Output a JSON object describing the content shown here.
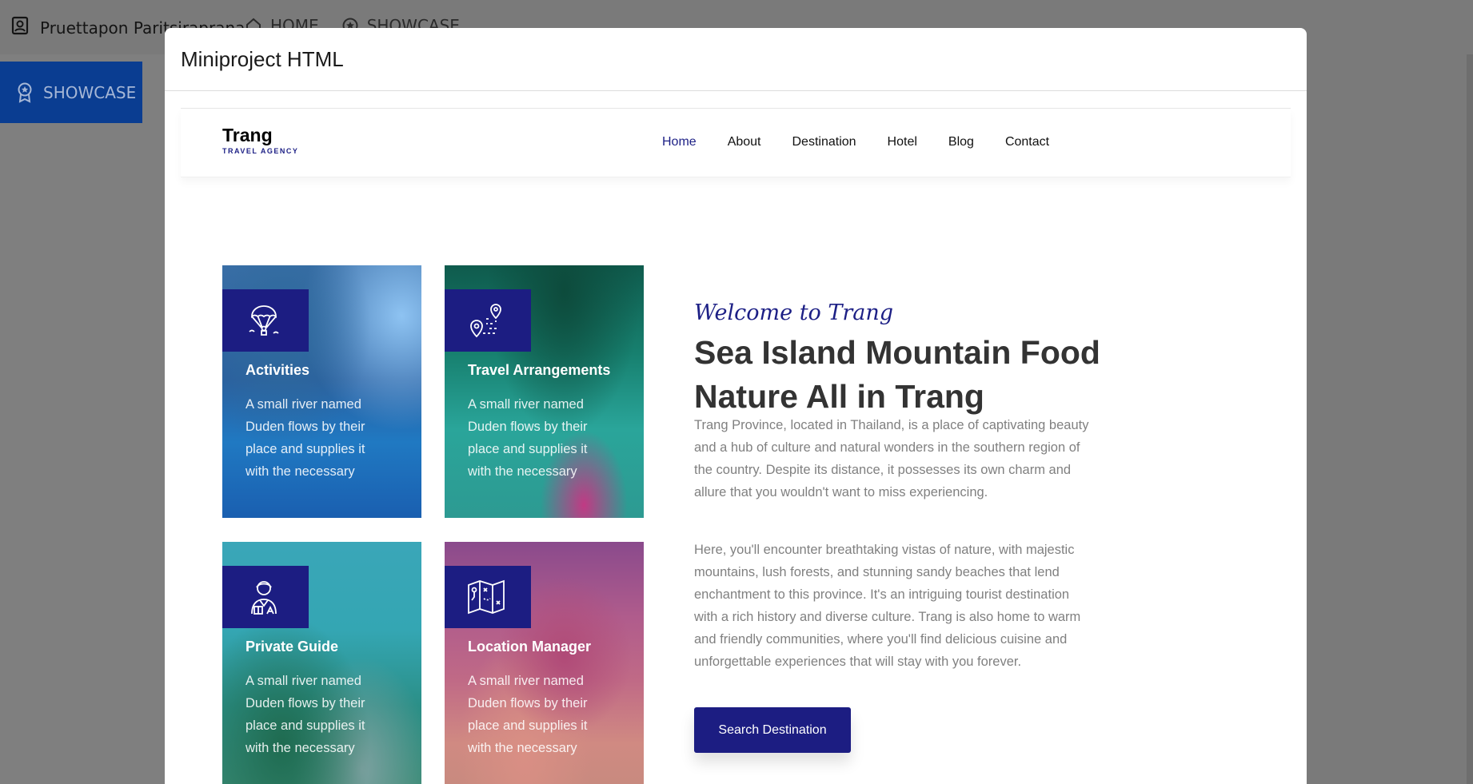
{
  "background": {
    "user_name": "Pruettapon Paritsiraprana",
    "nav": [
      {
        "label": "HOME",
        "icon": "home-icon"
      },
      {
        "label": "SHOWCASE",
        "icon": "star-badge-icon"
      }
    ],
    "sidebar_item": "SHOWCASE"
  },
  "modal": {
    "title": "Miniproject HTML"
  },
  "site": {
    "brand": {
      "name": "Trang",
      "tagline": "TRAVEL AGENCY"
    },
    "menu": [
      "Home",
      "About",
      "Destination",
      "Hotel",
      "Blog",
      "Contact"
    ],
    "active_menu": "Home",
    "accent_color": "#1c1d82",
    "cards": [
      {
        "title": "Activities",
        "text": "A small river named Duden flows by their place and supplies it with the necessary",
        "icon": "parachute-icon"
      },
      {
        "title": "Travel Arrangements",
        "text": "A small river named Duden flows by their place and supplies it with the necessary",
        "icon": "route-map-pin-icon"
      },
      {
        "title": "Private Guide",
        "text": "A small river named Duden flows by their place and supplies it with the necessary",
        "icon": "tour-guide-icon"
      },
      {
        "title": "Location Manager",
        "text": "A small river named Duden flows by their place and supplies it with the necessary",
        "icon": "folded-map-icon"
      }
    ],
    "welcome": "Welcome to Trang",
    "headline": "Sea Island Mountain Food Nature All in Trang",
    "paragraph1": "Trang Province, located in Thailand, is a place of captivating beauty and a hub of culture and natural wonders in the southern region of the country. Despite its distance, it possesses its own charm and allure that you wouldn't want to miss experiencing.",
    "paragraph2": "Here, you'll encounter breathtaking vistas of nature, with majestic mountains, lush forests, and stunning sandy beaches that lend enchantment to this province. It's an intriguing tourist destination with a rich history and diverse culture. Trang is also home to warm and friendly communities, where you'll find delicious cuisine and unforgettable experiences that will stay with you forever.",
    "cta": "Search Destination"
  }
}
